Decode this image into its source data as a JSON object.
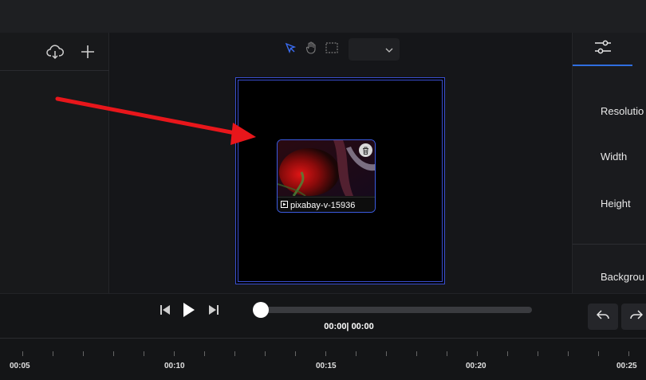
{
  "clip": {
    "name": "pixabay-v-15936"
  },
  "properties": {
    "resolution_label": "Resolutio",
    "width_label": "Width",
    "height_label": "Height",
    "background_label": "Backgrou"
  },
  "transport": {
    "time_display": "00:00| 00:00",
    "progress": 0
  },
  "timeline": {
    "ticks": [
      "00:05",
      "00:10",
      "00:15",
      "00:20",
      "00:25"
    ]
  },
  "colors": {
    "accent": "#3a4fd0",
    "arrow": "#e8161b",
    "active_tab_underline": "#2f6fe0"
  },
  "icons": {
    "cloud": "cloud-download-icon",
    "add": "plus-icon",
    "select": "pointer-icon",
    "hand": "hand-icon",
    "crop": "selection-rect-icon",
    "chevron": "chevron-down-icon",
    "settings": "sliders-icon",
    "undo": "undo-icon",
    "redo": "redo-icon"
  }
}
